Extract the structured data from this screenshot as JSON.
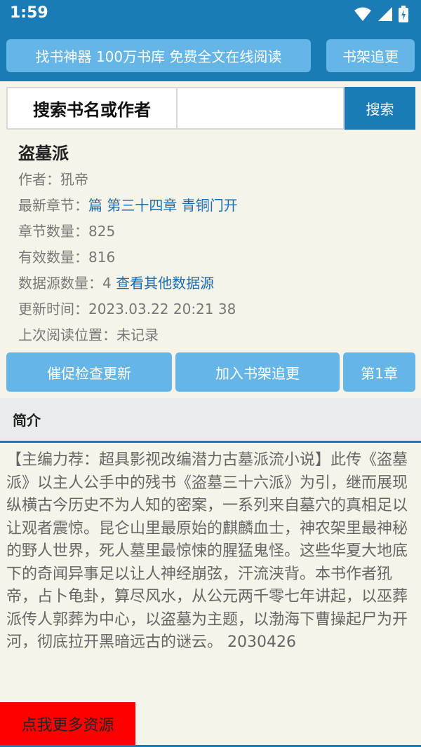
{
  "status_bar": {
    "time": "1:59"
  },
  "topbar": {
    "main_label": "找书神器 100万书库 免费全文在线阅读",
    "shelf_label": "书架追更"
  },
  "search": {
    "label": "搜索书名或作者",
    "value": "",
    "placeholder": "",
    "button_label": "搜索"
  },
  "book": {
    "title": "盗墓派",
    "author_label": "作者：",
    "author": "犼帝",
    "latest_label": "最新章节：",
    "latest": "篇 第三十四章 青铜门开",
    "chapter_count_label": "章节数量：",
    "chapter_count": "825",
    "valid_count_label": "有效数量：",
    "valid_count": "816",
    "source_count_label": "数据源数量：",
    "source_count": "4",
    "source_link": "查看其他数据源",
    "updated_label": "更新时间：",
    "updated": "2023.03.22 20:21 38",
    "last_read_label": "上次阅读位置：",
    "last_read": "未记录"
  },
  "actions": {
    "urge": "催促检查更新",
    "add_shelf": "加入书架追更",
    "first_chapter": "第1章"
  },
  "intro": {
    "heading": "简介",
    "text": "【主编力荐：超具影视改编潜力古墓派流小说】此传《盗墓派》以主人公手中的残书《盗墓三十六派》为引，继而展现纵横古今历史不为人知的密案，一系列来自墓穴的真相足以让观者震惊。昆仑山里最原始的麒麟血士，神农架里最神秘的野人世界，死人墓里最惊悚的腥猛鬼怪。这些华夏大地底下的奇闻异事足以让人神经崩弦，汗流浃背。本书作者犼帝，占卜龟卦，算尽风水，从公元两千零七年讲起，以巫葬派传人郭葬为中心，以盗墓为主题，以渤海下曹操起尸为开河，彻底拉开黑暗远古的谜云。 2030426"
  },
  "more_button": "点我更多资源",
  "colors": {
    "primary": "#1a7bb6",
    "button": "#65b5e6",
    "link": "#1a6db0",
    "background": "#f6f3e8",
    "promo": "#ff0000"
  }
}
